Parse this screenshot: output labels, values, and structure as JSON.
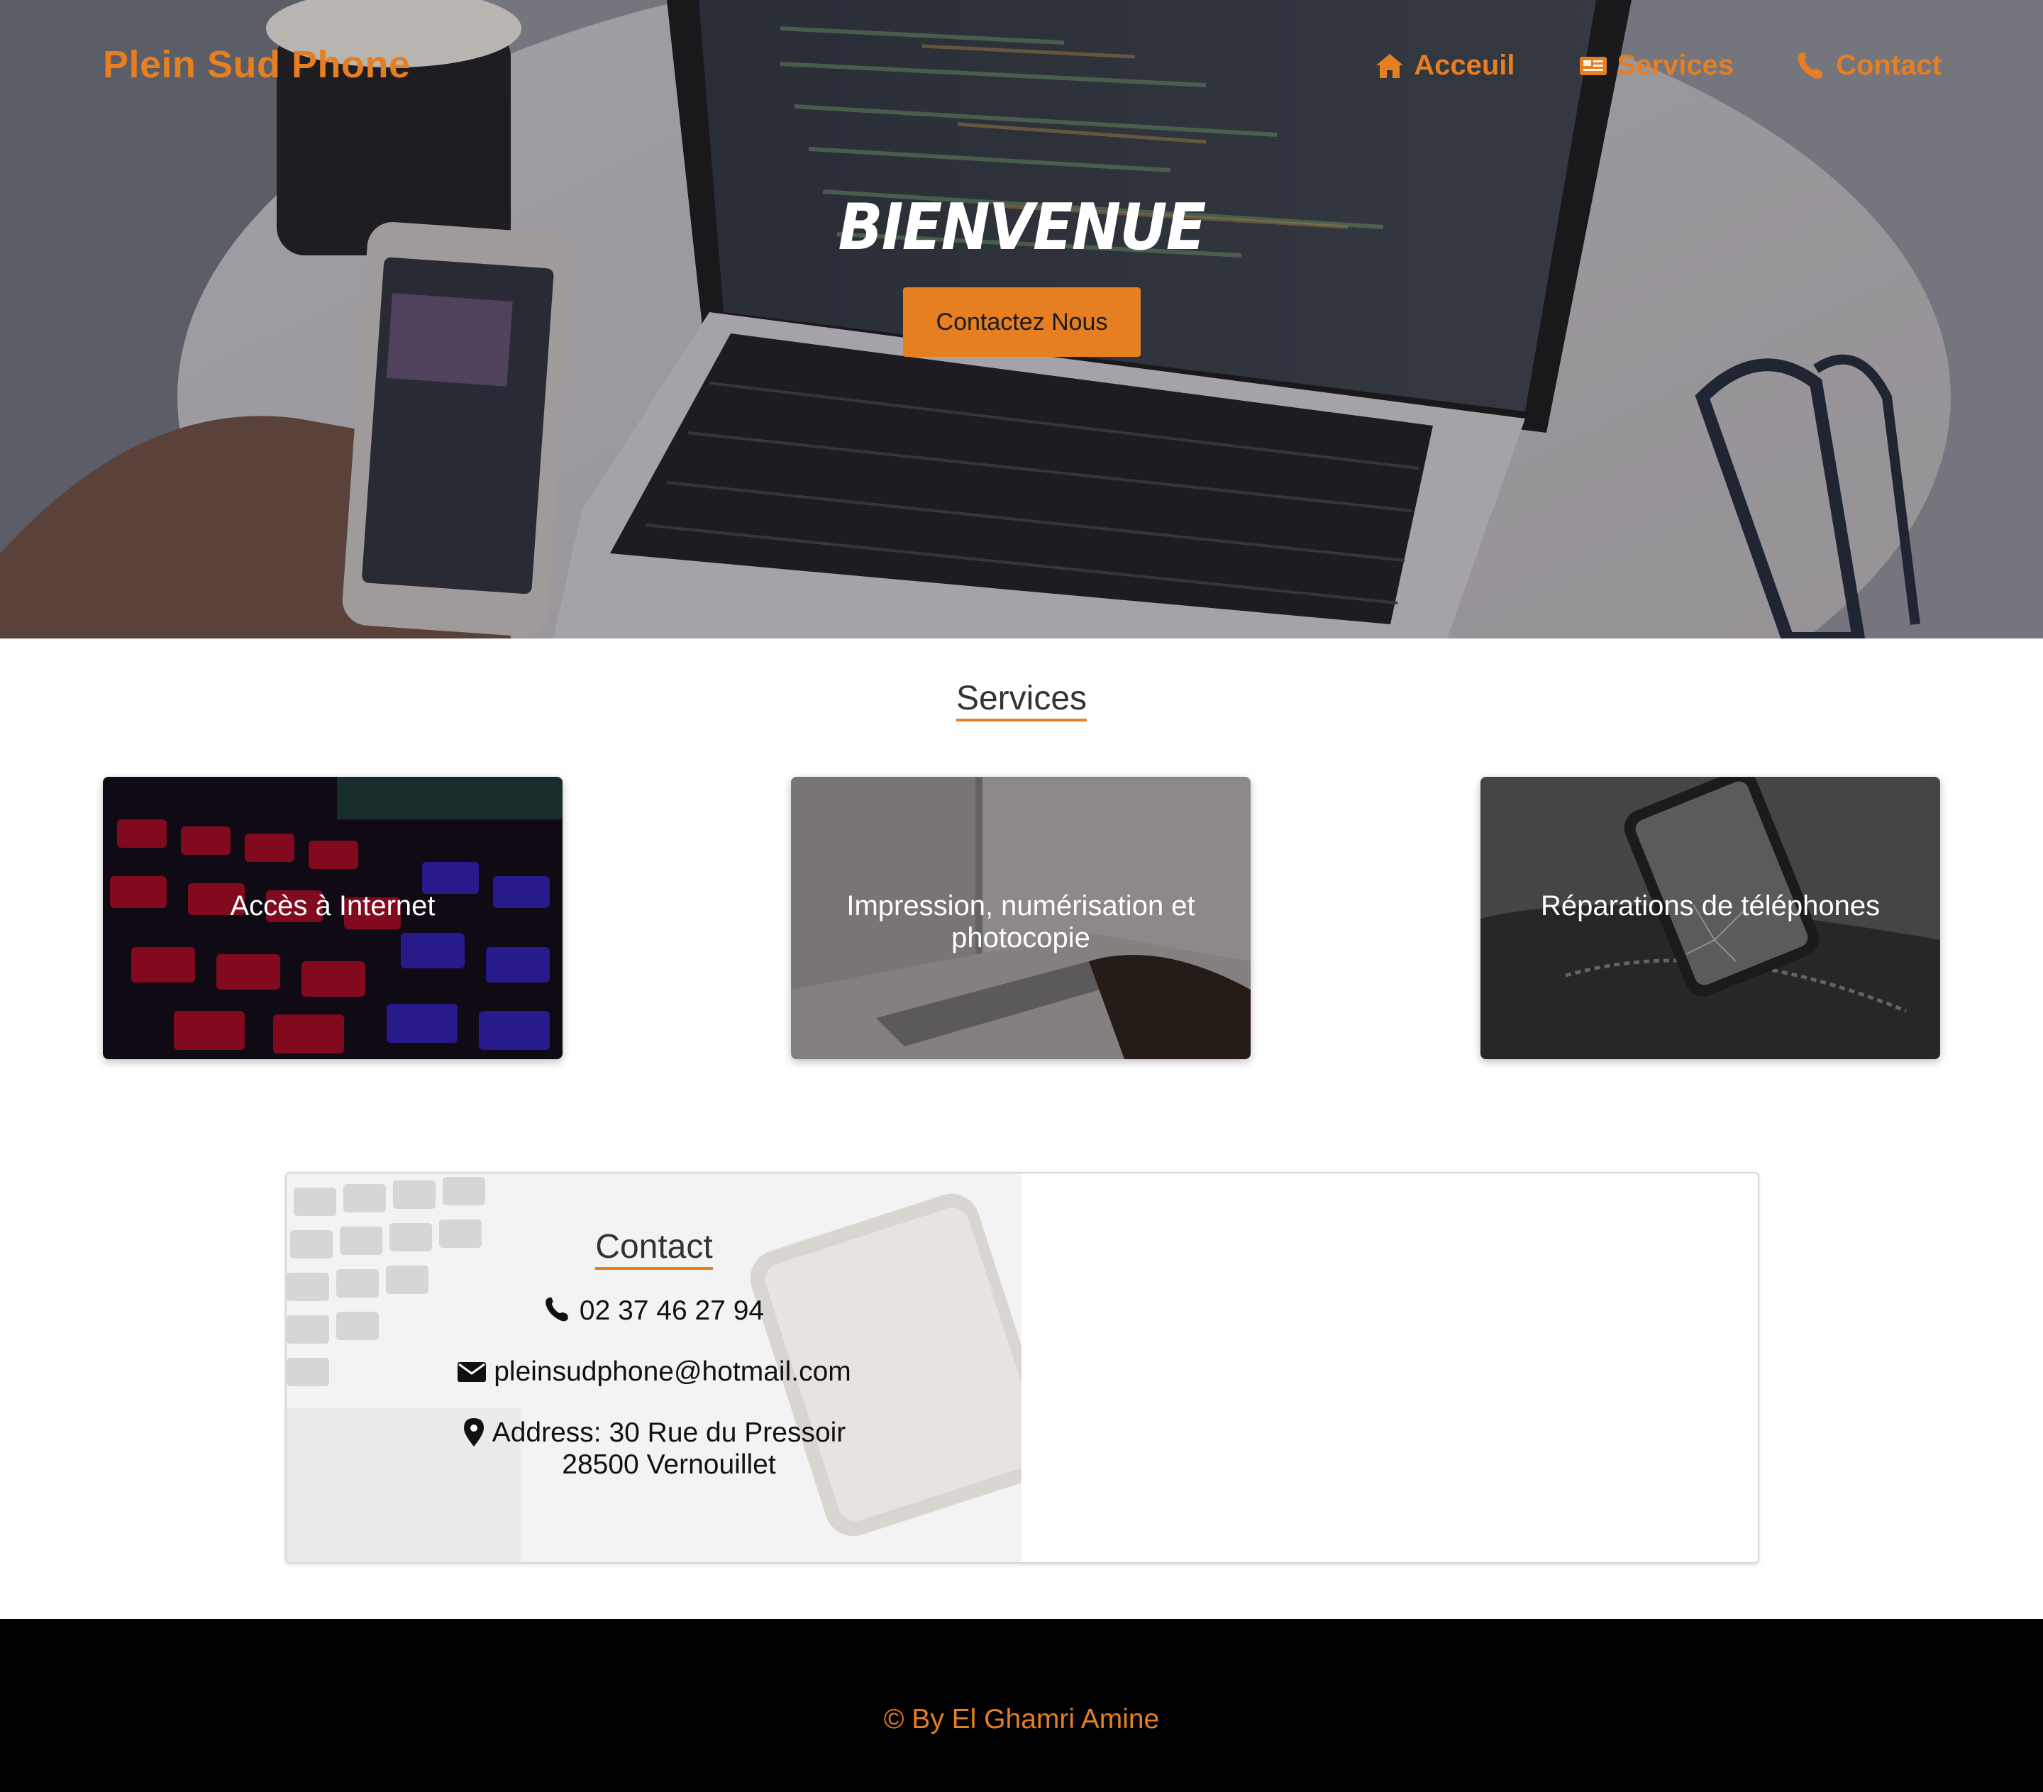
{
  "brand": {
    "name": "Plein Sud Phone"
  },
  "colors": {
    "accent": "#e67e22",
    "footer_bg": "#000000"
  },
  "nav": {
    "items": [
      {
        "label": "Acceuil",
        "icon": "home-icon"
      },
      {
        "label": "Services",
        "icon": "newspaper-icon"
      },
      {
        "label": "Contact",
        "icon": "phone-icon"
      }
    ]
  },
  "hero": {
    "title": "BIENVENUE",
    "button_label": "Contactez Nous"
  },
  "services": {
    "title": "Services",
    "cards": [
      {
        "label": "Accès à Internet"
      },
      {
        "label": "Impression, numérisation et photocopie"
      },
      {
        "label": "Réparations de téléphones"
      }
    ]
  },
  "contact": {
    "title": "Contact",
    "phone": "02 37 46 27 94",
    "email": "pleinsudphone@hotmail.com",
    "address_line1": "Address: 30 Rue du Pressoir",
    "address_line2": "28500 Vernouillet"
  },
  "footer": {
    "text": "© By El Ghamri Amine"
  }
}
